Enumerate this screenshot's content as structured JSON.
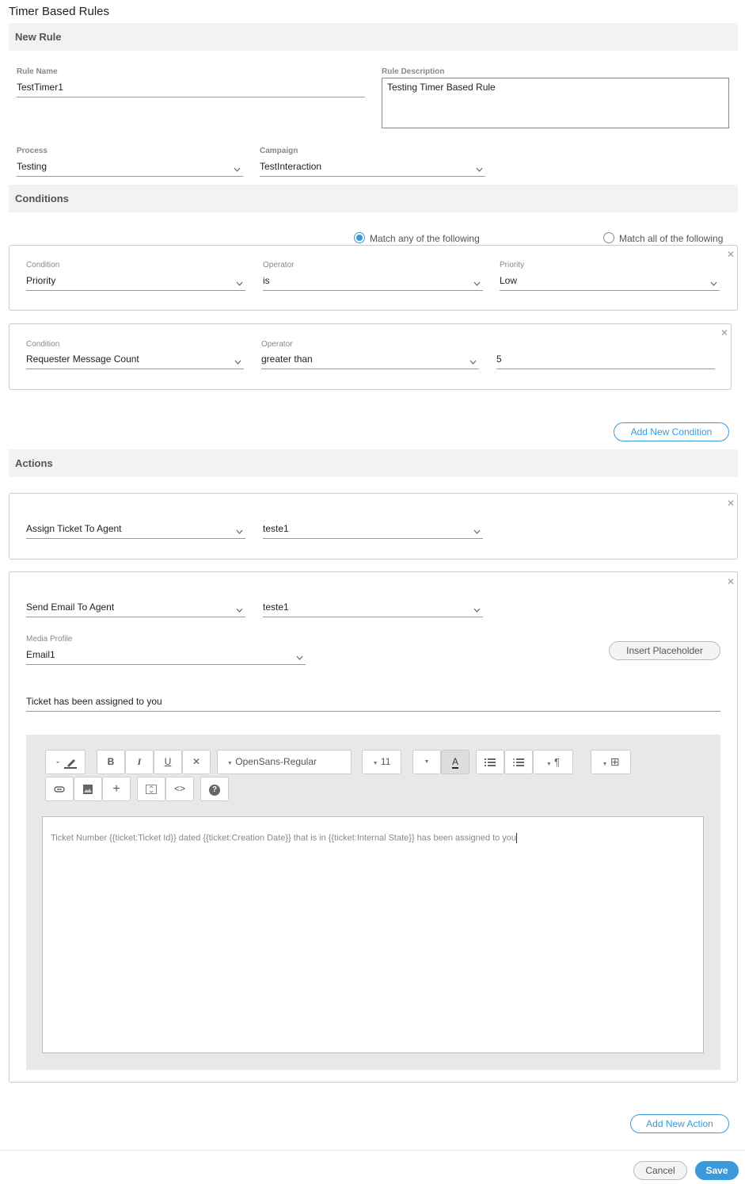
{
  "page": {
    "title": "Timer Based Rules"
  },
  "new_rule": {
    "section_label": "New Rule",
    "rule_name": {
      "label": "Rule Name",
      "value": "TestTimer1"
    },
    "rule_description": {
      "label": "Rule Description",
      "value": "Testing Timer Based Rule"
    },
    "process": {
      "label": "Process",
      "value": "Testing"
    },
    "campaign": {
      "label": "Campaign",
      "value": "TestInteraction"
    }
  },
  "conditions": {
    "section_label": "Conditions",
    "match_mode": {
      "options": [
        "Match any of the following",
        "Match all of the following"
      ],
      "selected": "Match any of the following"
    },
    "items": [
      {
        "condition": {
          "label": "Condition",
          "value": "Priority"
        },
        "operator": {
          "label": "Operator",
          "value": "is"
        },
        "value": {
          "label": "Priority",
          "value": "Low"
        }
      },
      {
        "condition": {
          "label": "Condition",
          "value": "Requester Message Count"
        },
        "operator": {
          "label": "Operator",
          "value": "greater than"
        },
        "value": {
          "label": "",
          "value": "5"
        }
      }
    ],
    "add_button": "Add New Condition"
  },
  "actions": {
    "section_label": "Actions",
    "items": [
      {
        "action": "Assign Ticket To Agent",
        "target": "teste1"
      },
      {
        "action": "Send Email To Agent",
        "target": "teste1",
        "media_profile": {
          "label": "Media Profile",
          "value": "Email1"
        },
        "insert_placeholder": "Insert Placeholder",
        "subject": "Ticket has been assigned to you",
        "editor": {
          "toolbar": {
            "font_family": "OpenSans-Regular",
            "font_size": "11",
            "icons": [
              "highlighter-icon",
              "bold-icon",
              "italic-icon",
              "underline-icon",
              "clear-format-icon",
              "font-family-dropdown",
              "font-size-dropdown",
              "color-dropdown-icon",
              "font-color-icon",
              "bullet-list-icon",
              "numbered-list-icon",
              "paragraph-icon",
              "table-icon",
              "link-icon",
              "image-icon",
              "add-icon",
              "fullscreen-icon",
              "code-view-icon",
              "help-icon"
            ]
          },
          "body": "Ticket Number {{ticket:Ticket Id}} dated {{ticket:Creation Date}} that is in {{ticket:Internal State}} has been assigned to you"
        }
      }
    ],
    "add_button": "Add New Action"
  },
  "footer": {
    "cancel": "Cancel",
    "save": "Save"
  },
  "colors": {
    "accent": "#3a9ad9",
    "section_bg": "#f2f2f2",
    "editor_bg": "#e8e8e8"
  }
}
